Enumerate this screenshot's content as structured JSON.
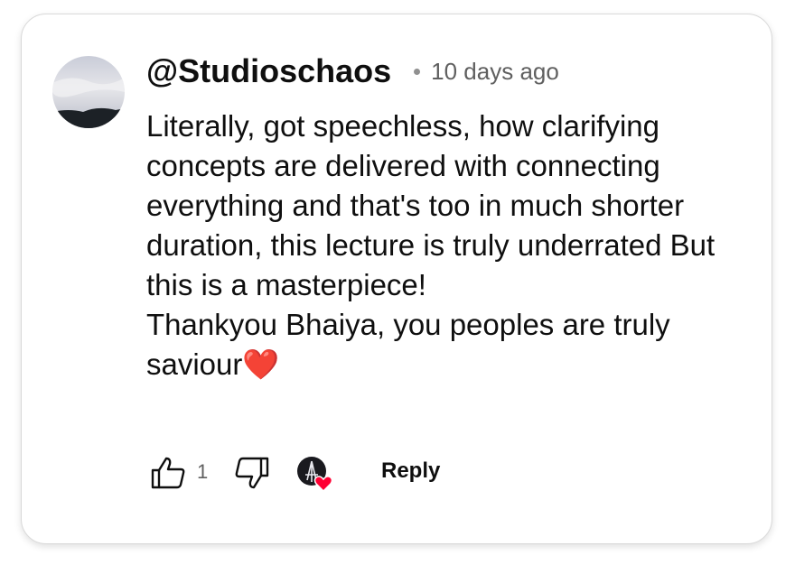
{
  "comment": {
    "author": "@Studioschaos",
    "timestamp": "10 days ago",
    "text_lines": [
      "Literally, got speechless, how clarifying concepts are delivered with connecting everything and that's too in much shorter duration, this lecture is truly underrated But this is a masterpiece!",
      "Thankyou Bhaiya, you peoples are truly saviour"
    ],
    "emoji": "❤️"
  },
  "actions": {
    "like_count": "1",
    "reply_label": "Reply",
    "creator_heart": true,
    "like_icon": "thumbs-up-icon",
    "dislike_icon": "thumbs-down-icon"
  },
  "colors": {
    "primary_text": "#0f0f0f",
    "secondary_text": "#606060",
    "heart": "#ff0033"
  }
}
